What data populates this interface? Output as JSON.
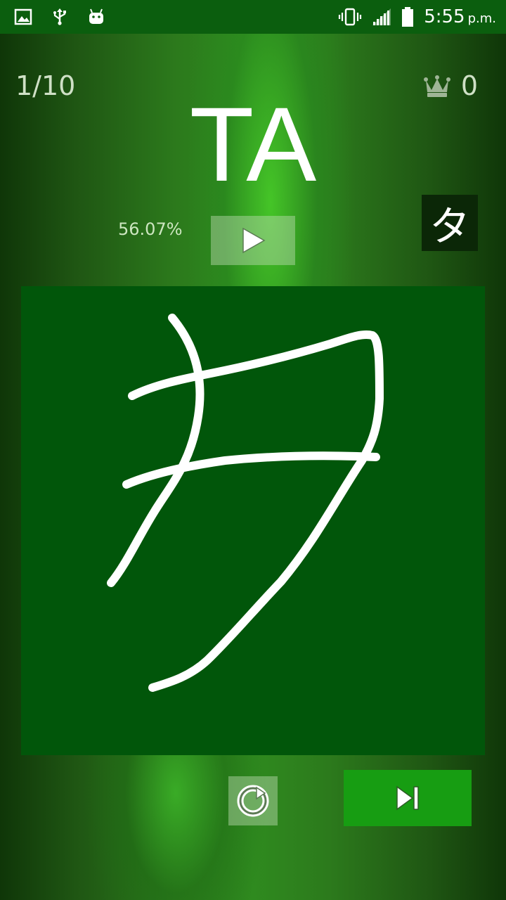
{
  "status_bar": {
    "time": "5:55",
    "ampm": "p.m.",
    "icons": [
      "image-icon",
      "usb-icon",
      "android-icon",
      "vibrate-icon",
      "signal-icon",
      "battery-icon"
    ]
  },
  "quiz": {
    "counter": "1/10",
    "score": "0",
    "romaji": "TA",
    "accuracy": "56.07%",
    "kana": "タ"
  },
  "colors": {
    "status_bar": "#0b5e0e",
    "canvas": "#01560a",
    "next_button": "#179d12",
    "kana_box": "#0b2707"
  },
  "controls": {
    "play": "play-icon",
    "reset": "reset-icon",
    "next": "skip-next-icon"
  }
}
